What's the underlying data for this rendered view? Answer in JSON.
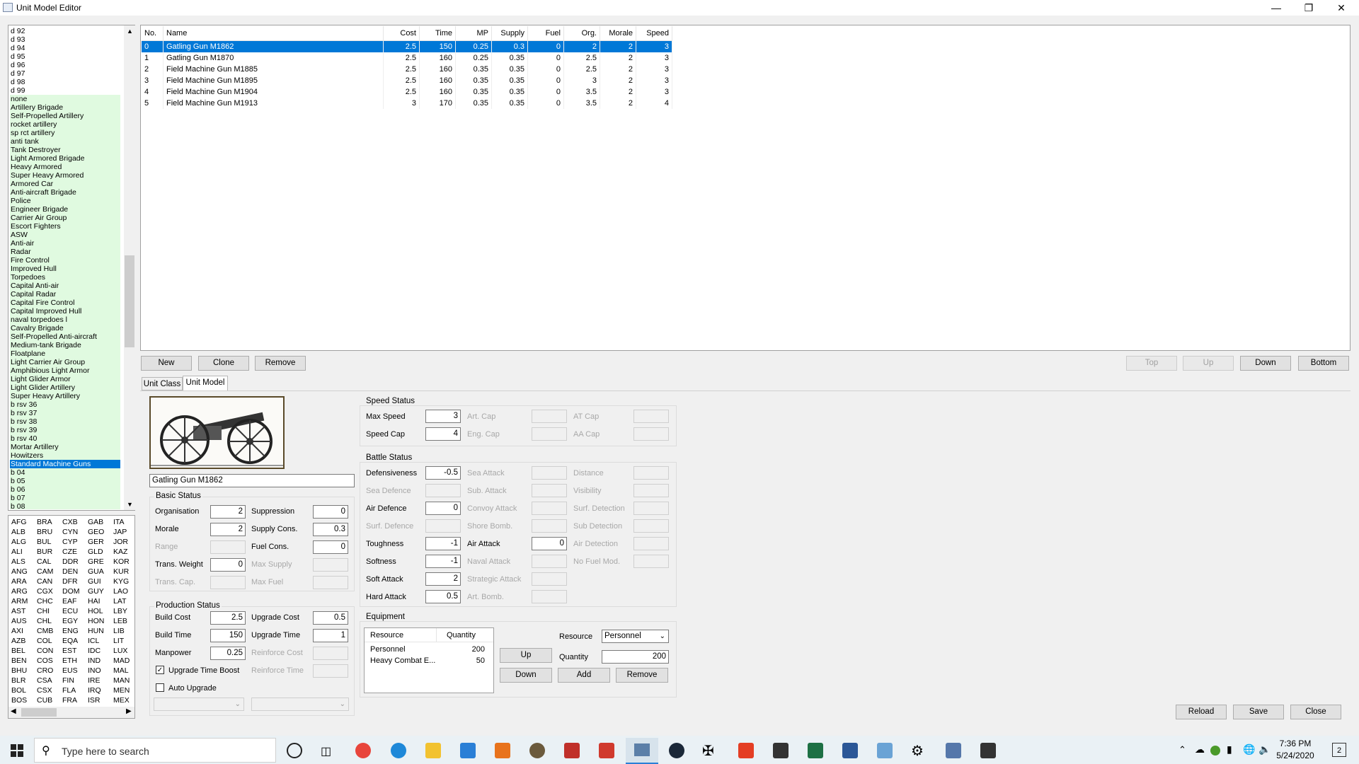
{
  "window": {
    "title": "Unit Model Editor"
  },
  "class_list": {
    "items": [
      "d 92",
      "d 93",
      "d 94",
      "d 95",
      "d 96",
      "d 97",
      "d 98",
      "d 99",
      "none",
      "Artillery Brigade",
      "Self-Propelled Artillery",
      "rocket artillery",
      "sp rct artillery",
      "anti tank",
      "Tank Destroyer",
      "Light Armored Brigade",
      "Heavy Armored",
      "Super Heavy Armored",
      "Armored Car",
      "Anti-aircraft Brigade",
      "Police",
      "Engineer Brigade",
      "Carrier Air Group",
      "Escort Fighters",
      "ASW",
      "Anti-air",
      "Radar",
      "Fire Control",
      "Improved Hull",
      "Torpedoes",
      "Capital Anti-air",
      "Capital Radar",
      "Capital Fire Control",
      "Capital Improved Hull",
      "naval torpedoes l",
      "Cavalry Brigade",
      "Self-Propelled Anti-aircraft",
      "Medium-tank Brigade",
      "Floatplane",
      "Light Carrier Air Group",
      "Amphibious Light Armor",
      "Light Glider Armor",
      "Light Glider Artillery",
      "Super Heavy Artillery",
      "b rsv 36",
      "b rsv 37",
      "b rsv 38",
      "b rsv 39",
      "b rsv 40",
      "Mortar Artillery",
      "Howitzers",
      "Standard Machine Guns",
      "b 04",
      "b 05",
      "b 06",
      "b 07",
      "b 08"
    ],
    "selected": "Standard Machine Guns"
  },
  "country_list": {
    "rows": [
      [
        "AFG",
        "BRA",
        "CXB",
        "GAB",
        "ITA"
      ],
      [
        "ALB",
        "BRU",
        "CYN",
        "GEO",
        "JAP"
      ],
      [
        "ALG",
        "BUL",
        "CYP",
        "GER",
        "JOR"
      ],
      [
        "ALI",
        "BUR",
        "CZE",
        "GLD",
        "KAZ"
      ],
      [
        "ALS",
        "CAL",
        "DDR",
        "GRE",
        "KOR"
      ],
      [
        "ANG",
        "CAM",
        "DEN",
        "GUA",
        "KUR"
      ],
      [
        "ARA",
        "CAN",
        "DFR",
        "GUI",
        "KYG"
      ],
      [
        "ARG",
        "CGX",
        "DOM",
        "GUY",
        "LAO"
      ],
      [
        "ARM",
        "CHC",
        "EAF",
        "HAI",
        "LAT"
      ],
      [
        "AST",
        "CHI",
        "ECU",
        "HOL",
        "LBY"
      ],
      [
        "AUS",
        "CHL",
        "EGY",
        "HON",
        "LEB"
      ],
      [
        "AXI",
        "CMB",
        "ENG",
        "HUN",
        "LIB"
      ],
      [
        "AZB",
        "COL",
        "EQA",
        "ICL",
        "LIT"
      ],
      [
        "BEL",
        "CON",
        "EST",
        "IDC",
        "LUX"
      ],
      [
        "BEN",
        "COS",
        "ETH",
        "IND",
        "MAD"
      ],
      [
        "BHU",
        "CRO",
        "EUS",
        "INO",
        "MAL"
      ],
      [
        "BLR",
        "CSA",
        "FIN",
        "IRE",
        "MAN"
      ],
      [
        "BOL",
        "CSX",
        "FLA",
        "IRQ",
        "MEN"
      ],
      [
        "BOS",
        "CUB",
        "FRA",
        "ISR",
        "MEX"
      ]
    ]
  },
  "models_table": {
    "headers": [
      "No.",
      "Name",
      "Cost",
      "Time",
      "MP",
      "Supply",
      "Fuel",
      "Org.",
      "Morale",
      "Speed"
    ],
    "rows": [
      [
        "0",
        "Gatling Gun M1862",
        "2.5",
        "150",
        "0.25",
        "0.3",
        "0",
        "2",
        "2",
        "3"
      ],
      [
        "1",
        "Gatling Gun M1870",
        "2.5",
        "160",
        "0.25",
        "0.35",
        "0",
        "2.5",
        "2",
        "3"
      ],
      [
        "2",
        "Field Machine Gun M1885",
        "2.5",
        "160",
        "0.35",
        "0.35",
        "0",
        "2.5",
        "2",
        "3"
      ],
      [
        "3",
        "Field Machine Gun M1895",
        "2.5",
        "160",
        "0.35",
        "0.35",
        "0",
        "3",
        "2",
        "3"
      ],
      [
        "4",
        "Field Machine Gun M1904",
        "2.5",
        "160",
        "0.35",
        "0.35",
        "0",
        "3.5",
        "2",
        "3"
      ],
      [
        "5",
        "Field Machine Gun M1913",
        "3",
        "170",
        "0.35",
        "0.35",
        "0",
        "3.5",
        "2",
        "4"
      ]
    ],
    "selected_row": 0
  },
  "list_buttons": {
    "new": "New",
    "clone": "Clone",
    "remove": "Remove",
    "top": "Top",
    "up": "Up",
    "down": "Down",
    "bottom": "Bottom"
  },
  "tabs": [
    {
      "label": "Unit Class"
    },
    {
      "label": "Unit Model"
    }
  ],
  "model_name": "Gatling Gun M1862",
  "basic_status": {
    "title": "Basic Status",
    "organisation_label": "Organisation",
    "organisation": "2",
    "morale_label": "Morale",
    "morale": "2",
    "range_label": "Range",
    "trans_weight_label": "Trans. Weight",
    "trans_weight": "0",
    "trans_cap_label": "Trans. Cap.",
    "suppression_label": "Suppression",
    "suppression": "0",
    "supply_cons_label": "Supply Cons.",
    "supply_cons": "0.3",
    "fuel_cons_label": "Fuel Cons.",
    "fuel_cons": "0",
    "max_supply_label": "Max Supply",
    "max_fuel_label": "Max Fuel"
  },
  "production_status": {
    "title": "Production Status",
    "build_cost_label": "Build Cost",
    "build_cost": "2.5",
    "build_time_label": "Build Time",
    "build_time": "150",
    "manpower_label": "Manpower",
    "manpower": "0.25",
    "upgrade_cost_label": "Upgrade Cost",
    "upgrade_cost": "0.5",
    "upgrade_time_label": "Upgrade Time",
    "upgrade_time": "1",
    "reinforce_cost_label": "Reinforce Cost",
    "reinforce_time_label": "Reinforce Time",
    "upgrade_time_boost_label": "Upgrade Time Boost",
    "upgrade_time_boost": true,
    "auto_upgrade_label": "Auto Upgrade",
    "auto_upgrade": false
  },
  "speed_status": {
    "title": "Speed Status",
    "max_speed_label": "Max Speed",
    "max_speed": "3",
    "speed_cap_label": "Speed Cap",
    "speed_cap": "4",
    "art_cap_label": "Art. Cap",
    "eng_cap_label": "Eng. Cap",
    "at_cap_label": "AT Cap",
    "aa_cap_label": "AA Cap"
  },
  "battle_status": {
    "title": "Battle Status",
    "defensiveness_label": "Defensiveness",
    "defensiveness": "-0.5",
    "sea_defence_label": "Sea Defence",
    "air_defence_label": "Air Defence",
    "air_defence": "0",
    "surf_defence_label": "Surf. Defence",
    "toughness_label": "Toughness",
    "toughness": "-1",
    "softness_label": "Softness",
    "softness": "-1",
    "soft_attack_label": "Soft Attack",
    "soft_attack": "2",
    "hard_attack_label": "Hard Attack",
    "hard_attack": "0.5",
    "sea_attack_label": "Sea Attack",
    "sub_attack_label": "Sub. Attack",
    "convoy_attack_label": "Convoy Attack",
    "shore_bomb_label": "Shore Bomb.",
    "air_attack_label": "Air Attack",
    "air_attack": "0",
    "naval_attack_label": "Naval Attack",
    "strategic_attack_label": "Strategic Attack",
    "art_bomb_label": "Art. Bomb.",
    "distance_label": "Distance",
    "visibility_label": "Visibility",
    "surf_detection_label": "Surf. Detection",
    "sub_detection_label": "Sub Detection",
    "air_detection_label": "Air Detection",
    "no_fuel_mod_label": "No Fuel Mod."
  },
  "equipment": {
    "title": "Equipment",
    "headers": [
      "Resource",
      "Quantity"
    ],
    "rows": [
      [
        "Personnel",
        "200"
      ],
      [
        "Heavy Combat E...",
        "50"
      ]
    ],
    "resource_label": "Resource",
    "resource_value": "Personnel",
    "quantity_label": "Quantity",
    "quantity_value": "200",
    "up": "Up",
    "down": "Down",
    "add": "Add",
    "remove": "Remove"
  },
  "bottom_buttons": {
    "reload": "Reload",
    "save": "Save",
    "close": "Close"
  },
  "taskbar": {
    "search_placeholder": "Type here to search",
    "time": "7:36 PM",
    "date": "5/24/2020",
    "notifications": "2"
  },
  "colors": {
    "selection": "#0078d7",
    "class_list_highlight": "#e0fae0",
    "taskbar": "#eaf1f5"
  }
}
